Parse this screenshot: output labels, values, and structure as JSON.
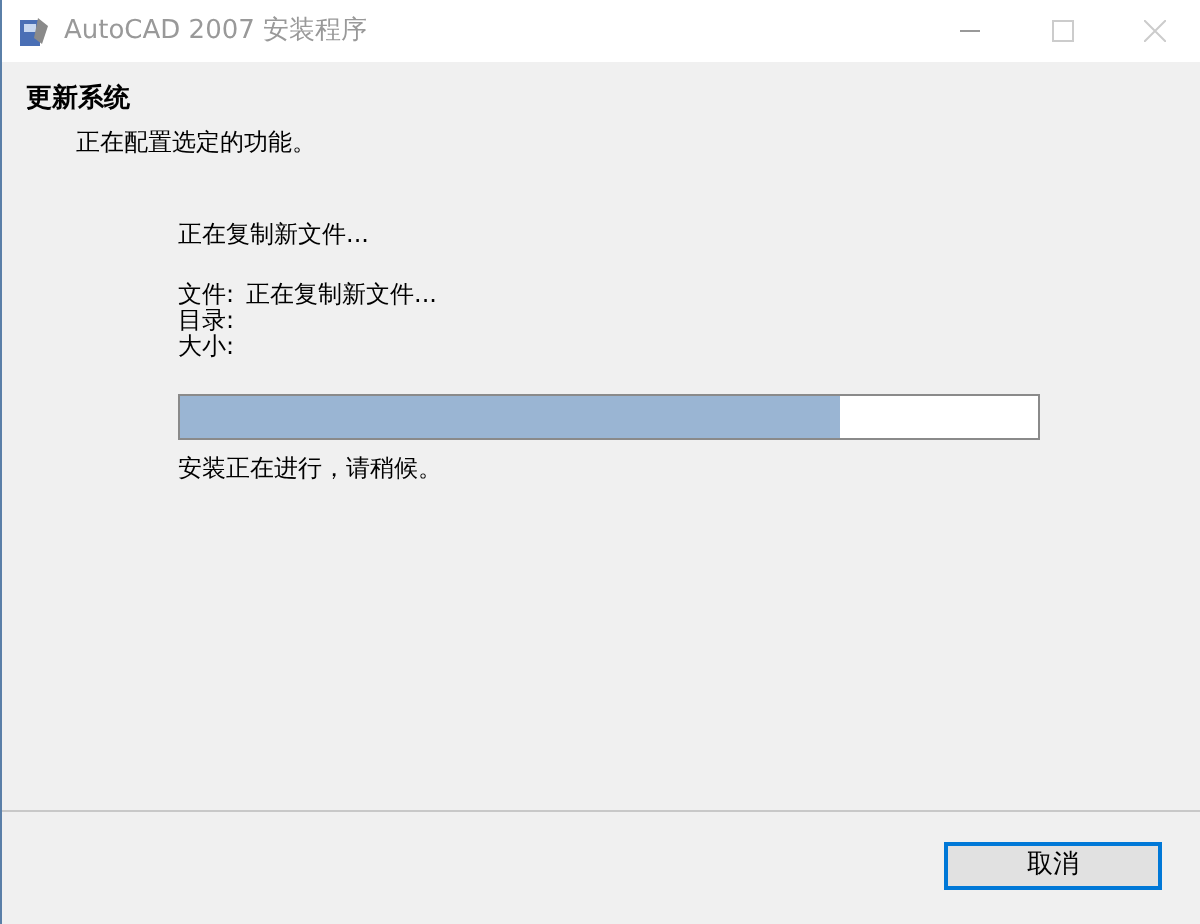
{
  "window": {
    "title": "AutoCAD 2007 安装程序"
  },
  "header": {
    "title": "更新系统",
    "subtitle": "正在配置选定的功能。"
  },
  "status": "正在复制新文件...",
  "details": [
    {
      "label": "文件:",
      "value": "正在复制新文件..."
    },
    {
      "label": "目录:"
    },
    {
      "label": "大小:"
    }
  ],
  "progress": {
    "level": 0.77
  },
  "message": "安装正在进行，请稍候。",
  "buttons": [
    {
      "label": "取消",
      "focused": true
    }
  ]
}
